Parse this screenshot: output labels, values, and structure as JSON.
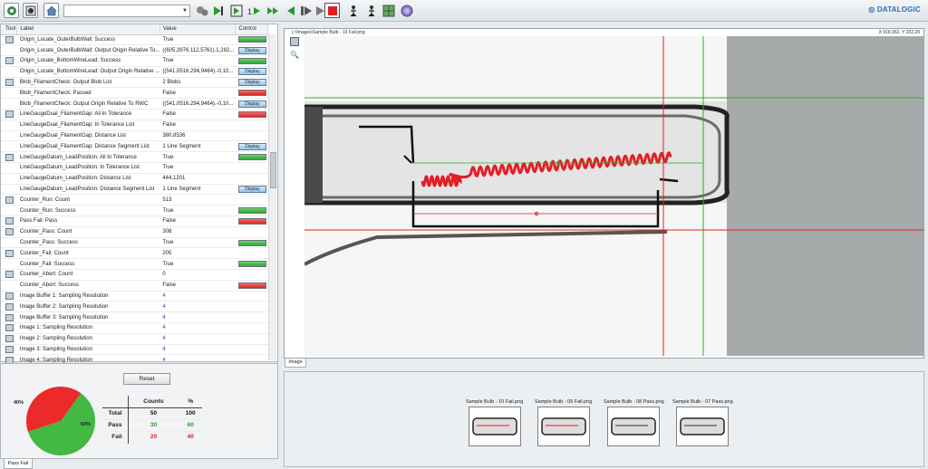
{
  "toolbar": {
    "combo_value": "",
    "icons": [
      "settings-icon",
      "record-icon",
      "home-icon",
      "gear-group-icon",
      "run-once-icon",
      "step-icon",
      "run-once-step-icon",
      "step-in-icon",
      "run-icon",
      "step-back-icon",
      "play-icon",
      "pause-icon",
      "stop-icon",
      "walk-icon",
      "walk-alt-icon",
      "grid-icon",
      "target-icon"
    ],
    "stop_color": "#e02020"
  },
  "brand": {
    "name": "DATALOGIC"
  },
  "tool_table": {
    "headers": {
      "tool": "Tool",
      "label": "Label",
      "value": "Value",
      "control": "Control"
    },
    "rows": [
      {
        "icon": true,
        "label": "Origin_Locate_OuterBulbWall: Success",
        "value": "True",
        "control": "green"
      },
      {
        "icon": false,
        "label": "Origin_Locate_OuterBulbWall: Output Origin Relative To...",
        "value": "((605,3976.112,5761).1,282...",
        "control": "display"
      },
      {
        "icon": true,
        "label": "Origin_Locate_BottomWireLead: Success",
        "value": "True",
        "control": "green"
      },
      {
        "icon": false,
        "label": "Origin_Locate_BottomWireLead: Output Origin Relative ...",
        "value": "((541,0516.294,9464).-0,10...",
        "control": "display"
      },
      {
        "icon": true,
        "label": "Blob_FilamentCheck: Output Blob List",
        "value": "2 Blobs",
        "control": "display"
      },
      {
        "icon": false,
        "label": "Blob_FilamentCheck: Passed",
        "value": "False",
        "control": "red"
      },
      {
        "icon": false,
        "label": "Blob_FilamentCheck: Output Origin Relative To RWC",
        "value": "((541,0516.294,9464).-0,10...",
        "control": "display"
      },
      {
        "icon": true,
        "label": "LineGaugeDual_FilamentGap: All In Tolerance",
        "value": "False",
        "control": "red"
      },
      {
        "icon": false,
        "label": "LineGaugeDual_FilamentGap: In Tolerance List",
        "value": "False",
        "control": ""
      },
      {
        "icon": false,
        "label": "LineGaugeDual_FilamentGap: Distance List",
        "value": "380,8536",
        "control": ""
      },
      {
        "icon": false,
        "label": "LineGaugeDual_FilamentGap: Distance Segment List",
        "value": "1 Line Segment",
        "control": "display"
      },
      {
        "icon": true,
        "label": "LineGaugeDatum_LeadPosition: All In Tolerance",
        "value": "True",
        "control": "green"
      },
      {
        "icon": false,
        "label": "LineGaugeDatum_LeadPosition: In Tolerance List",
        "value": "True",
        "control": ""
      },
      {
        "icon": false,
        "label": "LineGaugeDatum_LeadPosition: Distance List",
        "value": "444,1201",
        "control": ""
      },
      {
        "icon": false,
        "label": "LineGaugeDatum_LeadPosition: Distance Segment List",
        "value": "1 Line Segment",
        "control": "display"
      },
      {
        "icon": true,
        "label": "Counter_Run: Count",
        "value": "513",
        "control": ""
      },
      {
        "icon": false,
        "label": "Counter_Run: Success",
        "value": "True",
        "control": "green"
      },
      {
        "icon": true,
        "label": "Pass Fail: Pass",
        "value": "False",
        "control": "red"
      },
      {
        "icon": true,
        "label": "Counter_Pass: Count",
        "value": "308",
        "control": ""
      },
      {
        "icon": false,
        "label": "Counter_Pass: Success",
        "value": "True",
        "control": "green"
      },
      {
        "icon": true,
        "label": "Counter_Fail: Count",
        "value": "205",
        "control": ""
      },
      {
        "icon": false,
        "label": "Counter_Fail: Success",
        "value": "True",
        "control": "green"
      },
      {
        "icon": true,
        "label": "Counter_Abort: Count",
        "value": "0",
        "control": ""
      },
      {
        "icon": false,
        "label": "Counter_Abort: Success",
        "value": "False",
        "control": "red"
      },
      {
        "icon": true,
        "label": "Image Buffer 1: Sampling Resolution",
        "value": "4",
        "control": "",
        "purple": true
      },
      {
        "icon": true,
        "label": "Image Buffer 2: Sampling Resolution",
        "value": "4",
        "control": "",
        "purple": true
      },
      {
        "icon": true,
        "label": "Image Buffer 3: Sampling Resolution",
        "value": "4",
        "control": "",
        "purple": true
      },
      {
        "icon": true,
        "label": "Image 1: Sampling Resolution",
        "value": "4",
        "control": "",
        "purple": true
      },
      {
        "icon": true,
        "label": "Image 2: Sampling Resolution",
        "value": "4",
        "control": "",
        "purple": true
      },
      {
        "icon": true,
        "label": "Image 3: Sampling Resolution",
        "value": "4",
        "control": "",
        "purple": true
      },
      {
        "icon": true,
        "label": "Image 4: Sampling Resolution",
        "value": "4",
        "control": "",
        "purple": true
      }
    ],
    "display_label": "Display"
  },
  "stats": {
    "reset_label": "Reset",
    "fail_pct_label": "40%",
    "pass_pct_label": "60%",
    "fail_fraction": 0.4,
    "pass_color": "#43b843",
    "fail_color": "#ec2a2a",
    "headers": {
      "counts": "Counts",
      "pct": "%"
    },
    "rows": [
      {
        "label": "Total",
        "count": "50",
        "pct": "100",
        "color": "#111"
      },
      {
        "label": "Pass",
        "count": "30",
        "pct": "60",
        "color": "#2e9a2e"
      },
      {
        "label": "Fail",
        "count": "20",
        "pct": "40",
        "color": "#e02020"
      }
    ],
    "tab_label": "Pass Fail"
  },
  "image_view": {
    "path": "c:\\Images\\Sample Bulb - 10 Fail.png",
    "coords": "X 918,962,  Y 202,29",
    "tab_label": "Image",
    "tools": [
      "zoom-fit-icon",
      "zoom-icon"
    ]
  },
  "thumbnails": [
    {
      "caption": "Sample Bulb - 10 Fail.png"
    },
    {
      "caption": "Sample Bulb - 09 Fail.png"
    },
    {
      "caption": "Sample Bulb - 08 Pass.png"
    },
    {
      "caption": "Sample Bulb - 07 Pass.png"
    }
  ]
}
